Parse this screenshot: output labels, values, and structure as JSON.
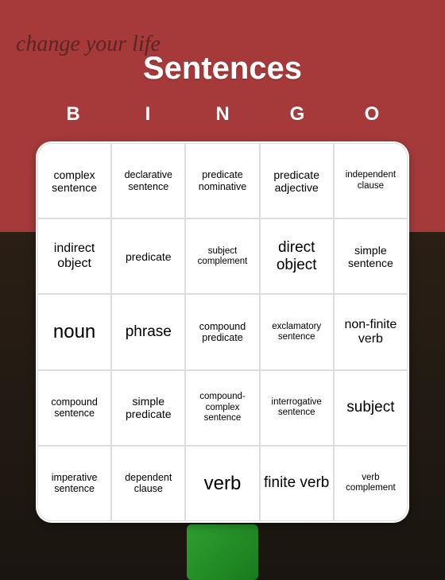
{
  "background_text": "change your life",
  "title": "Sentences",
  "headers": [
    "B",
    "I",
    "N",
    "G",
    "O"
  ],
  "cells": [
    {
      "text": "complex sentence",
      "size": "sm"
    },
    {
      "text": "declarative sentence",
      "size": "xs"
    },
    {
      "text": "predicate nominative",
      "size": "xs"
    },
    {
      "text": "predicate adjective",
      "size": "sm"
    },
    {
      "text": "independent clause",
      "size": "xxs"
    },
    {
      "text": "indirect object",
      "size": "md"
    },
    {
      "text": "predicate",
      "size": "sm"
    },
    {
      "text": "subject complement",
      "size": "xxs"
    },
    {
      "text": "direct object",
      "size": "lg"
    },
    {
      "text": "simple sentence",
      "size": "sm"
    },
    {
      "text": "noun",
      "size": "xl"
    },
    {
      "text": "phrase",
      "size": "lg"
    },
    {
      "text": "compound predicate",
      "size": "xs"
    },
    {
      "text": "exclamatory sentence",
      "size": "xxs"
    },
    {
      "text": "non-finite verb",
      "size": "md"
    },
    {
      "text": "compound sentence",
      "size": "xs"
    },
    {
      "text": "simple predicate",
      "size": "sm"
    },
    {
      "text": "compound-complex sentence",
      "size": "xxs"
    },
    {
      "text": "interrogative sentence",
      "size": "xxs"
    },
    {
      "text": "subject",
      "size": "lg"
    },
    {
      "text": "imperative sentence",
      "size": "xs"
    },
    {
      "text": "dependent clause",
      "size": "xs"
    },
    {
      "text": "verb",
      "size": "xl"
    },
    {
      "text": "finite verb",
      "size": "lg"
    },
    {
      "text": "verb complement",
      "size": "xxs"
    }
  ]
}
